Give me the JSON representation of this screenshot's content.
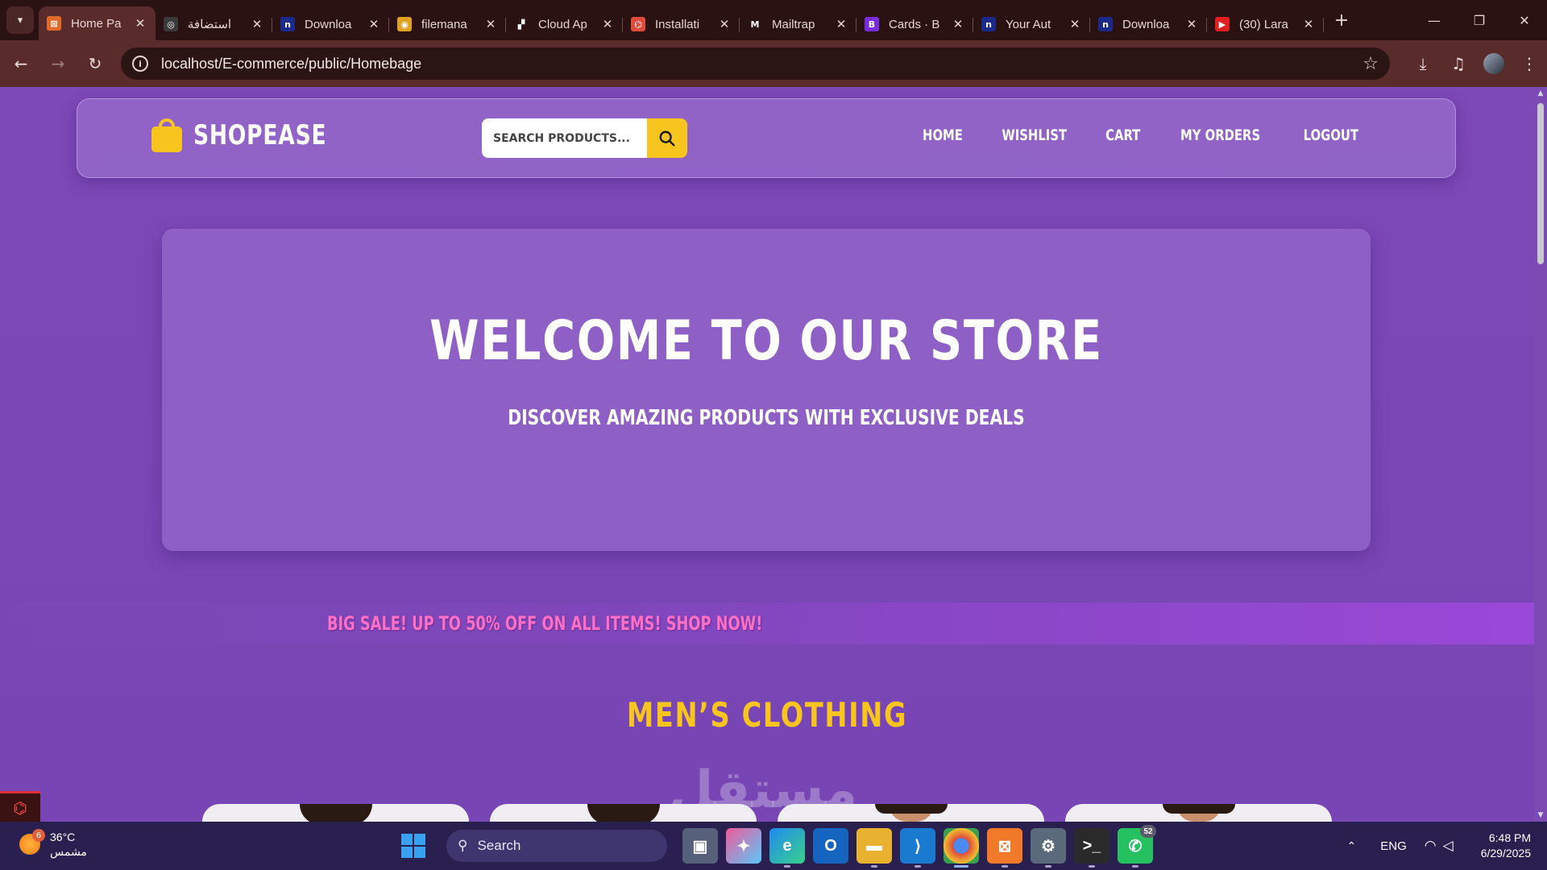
{
  "browser": {
    "tabs": [
      {
        "title": "Home Pa",
        "favicon_color": "#e06a2a",
        "favicon_glyph": "⊠",
        "active": true
      },
      {
        "title": "استضافة",
        "favicon_color": "#3a3a3a",
        "favicon_glyph": "◎",
        "active": false
      },
      {
        "title": "Downloa",
        "favicon_color": "#1b2a8a",
        "favicon_glyph": "n",
        "active": false
      },
      {
        "title": "filemana",
        "favicon_color": "#e0a020",
        "favicon_glyph": "◉",
        "active": false
      },
      {
        "title": "Cloud Ap",
        "favicon_color": "#2b1212",
        "favicon_glyph": "▞",
        "active": false
      },
      {
        "title": "Installati",
        "favicon_color": "#e04a3a",
        "favicon_glyph": "⌬",
        "active": false
      },
      {
        "title": "Mailtrap",
        "favicon_color": "#2b1212",
        "favicon_glyph": "M",
        "active": false
      },
      {
        "title": "Cards · B",
        "favicon_color": "#7a2ae0",
        "favicon_glyph": "B",
        "active": false
      },
      {
        "title": "Your Aut",
        "favicon_color": "#1b2a8a",
        "favicon_glyph": "n",
        "active": false
      },
      {
        "title": "Downloa",
        "favicon_color": "#1b2a8a",
        "favicon_glyph": "n",
        "active": false
      },
      {
        "title": "(30) Lara",
        "favicon_color": "#e02020",
        "favicon_glyph": "▶",
        "active": false
      }
    ],
    "url": "localhost/E-commerce/public/Homebage"
  },
  "site": {
    "brand": "SHOPEASE",
    "search_placeholder": "SEARCH PRODUCTS...",
    "menu": [
      "HOME",
      "WISHLIST",
      "CART",
      "MY ORDERS",
      "LOGOUT"
    ],
    "hero_title": "WELCOME TO OUR STORE",
    "hero_subtitle": "DISCOVER AMAZING PRODUCTS WITH EXCLUSIVE DEALS",
    "sale_banner": "BIG SALE! UP TO 50% OFF ON ALL ITEMS! SHOP NOW!",
    "section_title": "MEN’S CLOTHING",
    "product_count_visible": 4,
    "watermark": "مستقل",
    "colors": {
      "accent": "#f7c51e",
      "sale": "#ff6fc7",
      "background": "#7a48b8"
    }
  },
  "taskbar": {
    "weather_temp": "36°C",
    "weather_desc": "مشمس",
    "weather_badge": "6",
    "search_label": "Search",
    "whatsapp_count": "52",
    "language": "ENG",
    "time": "6:48 PM",
    "date": "6/29/2025"
  }
}
